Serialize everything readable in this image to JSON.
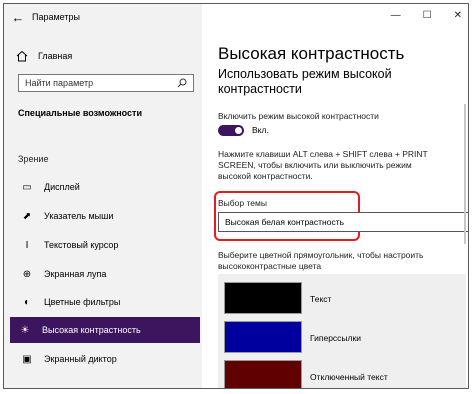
{
  "window": {
    "title": "Параметры",
    "back_icon": "←",
    "minimize_icon": "—",
    "maximize_icon": "☐",
    "close_icon": "✕"
  },
  "sidebar": {
    "home_label": "Главная",
    "search_placeholder": "Найти параметр",
    "section_title": "Специальные возможности",
    "group_label": "Зрение",
    "items": [
      {
        "label": "Дисплей",
        "icon": "monitor-icon"
      },
      {
        "label": "Указатель мыши",
        "icon": "mouse-pointer-icon"
      },
      {
        "label": "Текстовый курсор",
        "icon": "text-cursor-icon"
      },
      {
        "label": "Экранная лупа",
        "icon": "magnifier-icon"
      },
      {
        "label": "Цветные фильтры",
        "icon": "color-filter-icon"
      },
      {
        "label": "Высокая контрастность",
        "icon": "contrast-icon",
        "active": true
      },
      {
        "label": "Экранный диктор",
        "icon": "narrator-icon"
      }
    ]
  },
  "main": {
    "title": "Высокая контрастность",
    "subtitle": "Использовать режим высокой контрастности",
    "toggle_label": "Включить режим высокой контрастности",
    "toggle_state": "Вкл.",
    "hint": "Нажмите клавиши ALT слева + SHIFT слева + PRINT SCREEN, чтобы включить или выключить режим высокой контрастности.",
    "theme_label": "Выбор темы",
    "theme_value": "Высокая белая контрастность",
    "color_hint": "Выберите цветной прямоугольник, чтобы настроить высококонтрастные цвета",
    "swatches": [
      {
        "label": "Текст",
        "color": "#000000"
      },
      {
        "label": "Гиперссылки",
        "color": "#00009f"
      },
      {
        "label": "Отключенный текст",
        "color": "#600000"
      }
    ]
  },
  "colors": {
    "accent": "#3d145e",
    "highlight_box": "#e31c23"
  }
}
